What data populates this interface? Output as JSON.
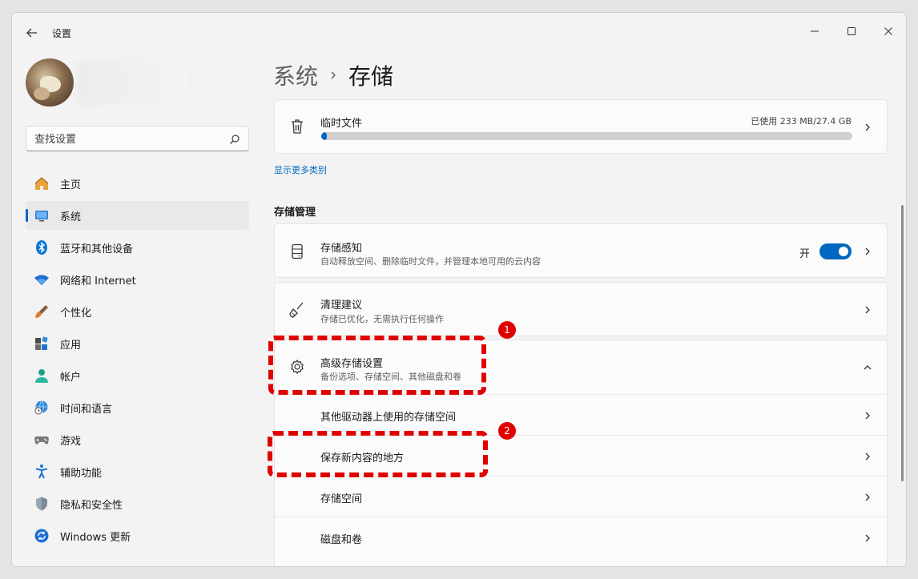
{
  "window": {
    "title": "设置",
    "controls": {
      "minimize": "minimize-icon",
      "maximize": "maximize-icon",
      "close": "close-icon"
    }
  },
  "sidebar": {
    "search_placeholder": "查找设置",
    "items": [
      {
        "label": "主页",
        "icon": "home-icon"
      },
      {
        "label": "系统",
        "icon": "system-icon",
        "active": true
      },
      {
        "label": "蓝牙和其他设备",
        "icon": "bluetooth-icon"
      },
      {
        "label": "网络和 Internet",
        "icon": "wifi-icon"
      },
      {
        "label": "个性化",
        "icon": "brush-icon"
      },
      {
        "label": "应用",
        "icon": "apps-icon"
      },
      {
        "label": "帐户",
        "icon": "account-icon"
      },
      {
        "label": "时间和语言",
        "icon": "globe-clock-icon"
      },
      {
        "label": "游戏",
        "icon": "gamepad-icon"
      },
      {
        "label": "辅助功能",
        "icon": "accessibility-icon"
      },
      {
        "label": "隐私和安全性",
        "icon": "shield-icon"
      },
      {
        "label": "Windows 更新",
        "icon": "update-icon"
      }
    ]
  },
  "breadcrumb": {
    "parent": "系统",
    "current": "存储"
  },
  "temp_files": {
    "title": "临时文件",
    "usage": "已使用 233 MB/27.4 GB",
    "used_fraction": 0.0085
  },
  "show_more": "显示更多类别",
  "storage_management": {
    "title": "存储管理",
    "storage_sense": {
      "title": "存储感知",
      "subtitle": "自动释放空间、删除临时文件，并管理本地可用的云内容",
      "toggle_label": "开",
      "toggle_on": true
    },
    "cleanup": {
      "title": "清理建议",
      "subtitle": "存储已优化，无需执行任何操作"
    },
    "advanced": {
      "title": "高级存储设置",
      "subtitle": "备份选项、存储空间、其他磁盘和卷",
      "expanded": true,
      "rows": [
        {
          "label": "其他驱动器上使用的存储空间"
        },
        {
          "label": "保存新内容的地方"
        },
        {
          "label": "存储空间"
        },
        {
          "label": "磁盘和卷"
        }
      ]
    }
  },
  "annotations": [
    {
      "number": "1"
    },
    {
      "number": "2"
    }
  ],
  "colors": {
    "accent": "#0067c0",
    "annotation": "#e00000"
  }
}
